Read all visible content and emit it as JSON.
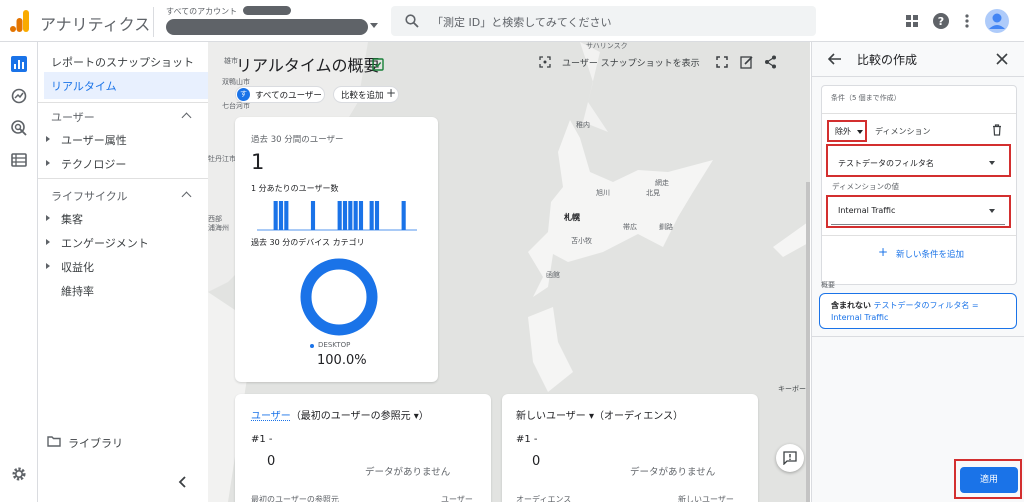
{
  "header": {
    "app_name": "アナリティクス",
    "account_label": "すべてのアカウント",
    "search_placeholder": "「測定 ID」と検索してみてください"
  },
  "nav": {
    "snapshot": "レポートのスナップショット",
    "realtime": "リアルタイム",
    "user_section": "ユーザー",
    "user_items": [
      "ユーザー属性",
      "テクノロジー"
    ],
    "lifecycle_section": "ライフサイクル",
    "lifecycle_items": [
      "集客",
      "エンゲージメント",
      "収益化",
      "維持率"
    ],
    "library": "ライブラリ"
  },
  "report": {
    "title": "リアルタイムの概要",
    "user_chip_letter": "す",
    "user_chip": "すべてのユーザー",
    "add_comparison": "比較を追加",
    "snapshot_button": "ユーザー スナップショットを表示",
    "users_card": {
      "label": "過去 30 分間のユーザー",
      "value": "1",
      "per_minute_label": "1 分あたりのユーザー数",
      "device_label": "過去 30 分のデバイス カテゴリ",
      "legend": "DESKTOP",
      "percent": "100.0%"
    },
    "card2": {
      "title_main": "ユーザー",
      "title_rest": "（最初のユーザーの参照元 ▾）",
      "rank": "#1  -",
      "value": "0",
      "no_data": "データがありません",
      "col1": "最初のユーザーの参照元",
      "col2": "ユーザー"
    },
    "card3": {
      "title_main": "新しいユーザー ▾",
      "title_rest": "（オーディエンス）",
      "rank": "#1  -",
      "value": "0",
      "no_data": "データがありません",
      "col1": "オーディエンス",
      "col2": "新しいユーザー"
    },
    "keyboard_hint": "キーボー|"
  },
  "map_labels": {
    "top": "サハリンスク",
    "left1": "雄市",
    "left2": "双鴨山市",
    "left3": "七台河市",
    "left4": "牡丹江市",
    "left5": "西部",
    "left6": "浦海州",
    "city1": "札幌",
    "city2": "苫小牧",
    "city3": "函館",
    "city4": "旭川",
    "city5": "北見",
    "city6": "帯広",
    "city7": "釧路",
    "city8": "稚内",
    "city9": "網走"
  },
  "chart_data": {
    "type": "bar",
    "title": "1 分あたりのユーザー数",
    "values": [
      0,
      0,
      0,
      1,
      1,
      1,
      0,
      0,
      0,
      0,
      1,
      0,
      0,
      0,
      0,
      1,
      1,
      1,
      1,
      1,
      0,
      1,
      1,
      0,
      0,
      0,
      0,
      1,
      0,
      0
    ],
    "ylim": [
      0,
      1
    ]
  },
  "donut": {
    "series": [
      {
        "name": "DESKTOP",
        "value": 100.0
      }
    ],
    "color": "#1a73e8"
  },
  "panel": {
    "title": "比較の作成",
    "conditions_label": "条件（5 個まで作成）",
    "exclude": "除外",
    "dimension_label": "ディメンション",
    "dimension_value": "テストデータのフィルタ名",
    "dimension_value_label": "ディメンションの値",
    "value_value": "Internal Traffic",
    "add_condition": "新しい条件を追加",
    "summary_label": "概要",
    "summary_bold": "含まれない",
    "summary_rest": "テストデータのフィルタ名 =",
    "summary_value": "Internal Traffic",
    "apply": "適用"
  },
  "colors": {
    "accent": "#1a73e8",
    "highlight": "#d32f2f",
    "logo_orange": "#f9ab00",
    "logo_dark": "#e37400"
  }
}
